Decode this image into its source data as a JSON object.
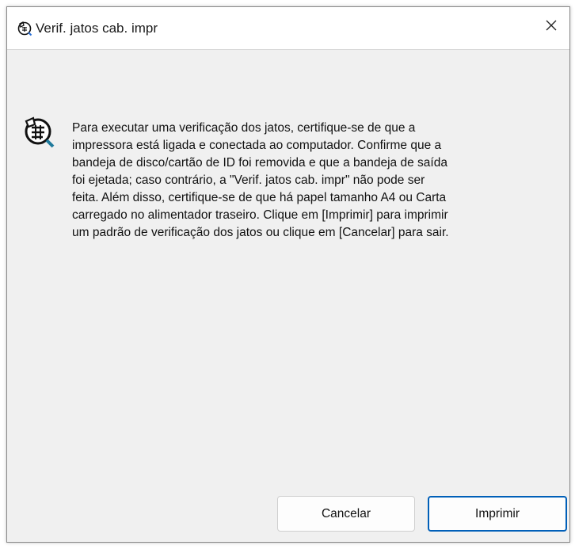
{
  "window": {
    "title": "Verif. jatos cab. impr",
    "title_icon": "nozzle-check-icon",
    "close_icon": "close-icon"
  },
  "content": {
    "icon": "nozzle-check-icon",
    "lines": [
      "Para executar uma verificação dos jatos, certifique-se de que a",
      "impressora está ligada e conectada ao computador. Confirme que a",
      "bandeja de disco/cartão de ID foi removida e que a bandeja de saída",
      "foi ejetada; caso contrário, a \"Verif. jatos cab. impr\" não pode ser",
      "feita. Além disso, certifique-se de que há papel tamanho A4 ou Carta",
      "carregado no alimentador traseiro. Clique em [Imprimir] para imprimir",
      "um padrão de verificação dos jatos ou clique em [Cancelar] para sair."
    ]
  },
  "buttons": {
    "cancel_label": "Cancelar",
    "print_label": "Imprimir"
  },
  "colors": {
    "window_bg": "#f0f0f0",
    "titlebar_bg": "#ffffff",
    "default_button_border": "#005fb8"
  }
}
